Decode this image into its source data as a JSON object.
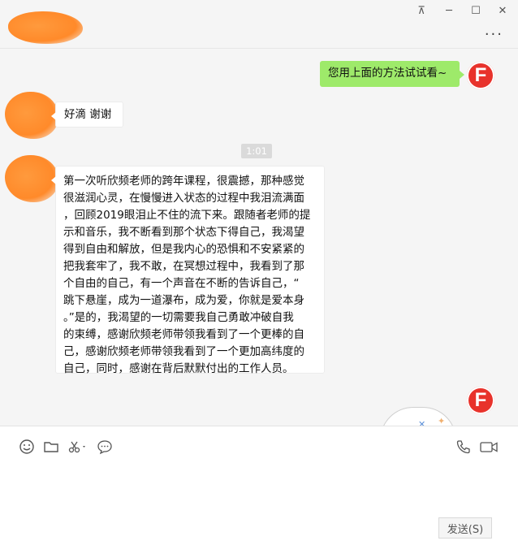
{
  "window": {
    "pin_glyph": "⊼",
    "minimize_glyph": "─",
    "maximize_glyph": "☐",
    "close_glyph": "✕",
    "more_glyph": "···"
  },
  "messages": {
    "outgoing_1": "您用上面的方法试试看~",
    "incoming_1": "好滴  谢谢",
    "timestamp": "1:01",
    "incoming_2": "第一次听欣频老师的跨年课程，很震撼，那种感觉\n很滋润心灵，在慢慢进入状态的过程中我泪流满面\n，回顾2019眼泪止不住的流下来。跟随者老师的提\n示和音乐，我不断看到那个状态下得自己，我渴望\n得到自由和解放，但是我内心的恐惧和不安紧紧的\n把我套牢了，我不敢，在冥想过程中，我看到了那\n个自由的自己，有一个声音在不断的告诉自己，“\n跳下悬崖，成为一道瀑布，成为爱，你就是爱本身\n。”是的，我渴望的一切需要我自己勇敢冲破自我\n的束缚，感谢欣频老师带领我看到了一个更棒的自\n己，感谢欣频老师带领我看到了一个更加高纬度的\n自己，同时，感谢在背后默默付出的工作人员。"
  },
  "avatars": {
    "brand_letter": "F",
    "brand_color": "#e8322b",
    "blur_color": "#ff8a2a"
  },
  "input": {
    "send_label": "发送(S)"
  },
  "colors": {
    "outgoing_bubble": "#9eea6a",
    "incoming_bubble": "#ffffff",
    "background": "#f5f5f5"
  }
}
